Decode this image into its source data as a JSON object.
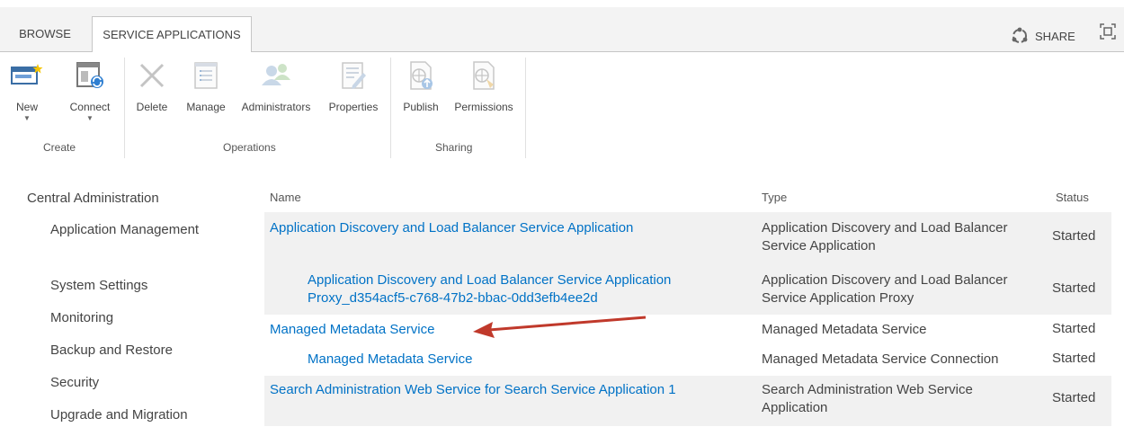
{
  "ribbon_tabs": {
    "browse": "BROWSE",
    "service_applications": "SERVICE APPLICATIONS",
    "share": "SHARE"
  },
  "ribbon": {
    "create": {
      "label": "Create",
      "new": "New",
      "connect": "Connect"
    },
    "operations": {
      "label": "Operations",
      "delete": "Delete",
      "manage": "Manage",
      "administrators": "Administrators",
      "properties": "Properties"
    },
    "sharing": {
      "label": "Sharing",
      "publish": "Publish",
      "permissions": "Permissions"
    }
  },
  "nav": {
    "root": "Central Administration",
    "items": [
      "Application Management",
      "System Settings",
      "Monitoring",
      "Backup and Restore",
      "Security",
      "Upgrade and Migration"
    ]
  },
  "table": {
    "columns": {
      "name": "Name",
      "type": "Type",
      "status": "Status"
    },
    "rows": [
      {
        "name": "Application Discovery and Load Balancer Service Application",
        "type": "Application Discovery and Load Balancer Service Application",
        "status": "Started"
      },
      {
        "name": "Application Discovery and Load Balancer Service Application Proxy_d354acf5-c768-47b2-bbac-0dd3efb4ee2d",
        "type": "Application Discovery and Load Balancer Service Application Proxy",
        "status": "Started"
      },
      {
        "name": "Managed Metadata Service",
        "type": "Managed Metadata Service",
        "status": "Started"
      },
      {
        "name": "Managed Metadata Service",
        "type": "Managed Metadata Service Connection",
        "status": "Started"
      },
      {
        "name": "Search Administration Web Service for Search Service Application 1",
        "type": "Search Administration Web Service Application",
        "status": "Started"
      }
    ]
  },
  "colors": {
    "link": "#0072c6",
    "text": "#444444",
    "row_shade": "#f1f1f1",
    "annotation_arrow": "#c0392b"
  }
}
